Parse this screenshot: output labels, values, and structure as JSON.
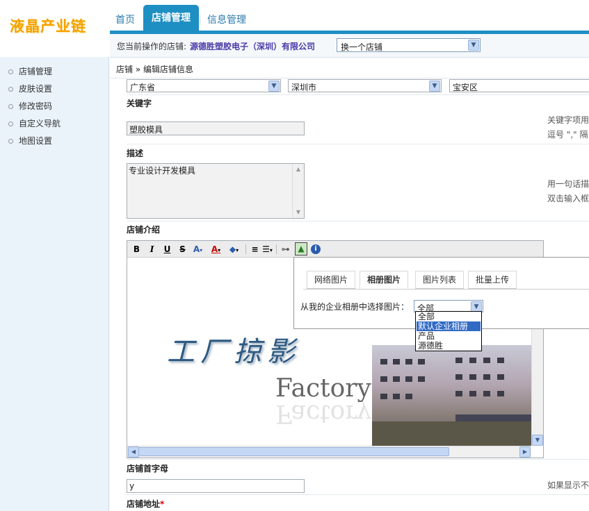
{
  "logo": {
    "text": "液晶产业链",
    "color": "#f5a200"
  },
  "nav": {
    "tabs": [
      "首页",
      "店铺管理",
      "信息管理"
    ],
    "active": "店铺管理",
    "accent": "#1e8fc3"
  },
  "subbar": {
    "current_label": "您当前操作的店铺:",
    "current_shop": "源德胜塑胶电子（深圳）有限公司",
    "switch_select": "换一个店铺"
  },
  "sidebar": {
    "items": [
      "店铺管理",
      "皮肤设置",
      "修改密码",
      "自定义导航",
      "地图设置"
    ]
  },
  "breadcrumb": {
    "text": "店铺 » 编辑店铺信息"
  },
  "form": {
    "location": {
      "province": "广东省",
      "city": "深圳市",
      "district": "宝安区"
    },
    "keywords": {
      "label": "关键字",
      "value": "塑胶模具",
      "hint_line1": "关键字项用",
      "hint_line2": "逗号 \",\" 隔"
    },
    "description": {
      "label": "描述",
      "value": "专业设计开发模具",
      "hint_line1": "用一句话描",
      "hint_line2": "双击输入框"
    },
    "intro": {
      "label": "店铺介绍"
    },
    "initial": {
      "label": "店铺首字母",
      "value": "y",
      "hint": "如果显示不"
    },
    "address": {
      "label": "店铺地址",
      "required_mark": "*"
    }
  },
  "editor": {
    "toolbar": [
      "bold-icon",
      "italic-icon",
      "underline-icon",
      "strikethrough-icon",
      "font-size-icon",
      "font-color-icon",
      "highlight-icon",
      "align-icon",
      "list-icon",
      "link-icon",
      "image-icon",
      "info-icon"
    ],
    "content": {
      "title_cn": "工厂掠影",
      "title_en": "Factory"
    }
  },
  "image_popup": {
    "tabs": [
      "网络图片",
      "相册图片",
      "图片列表",
      "批量上传"
    ],
    "active_tab": "相册图片",
    "album_label": "从我的企业相册中选择图片：",
    "album_selected": "全部",
    "album_options": [
      "全部",
      "默认企业相册",
      "产品",
      "源德胜"
    ],
    "album_highlighted": "默认企业相册"
  }
}
